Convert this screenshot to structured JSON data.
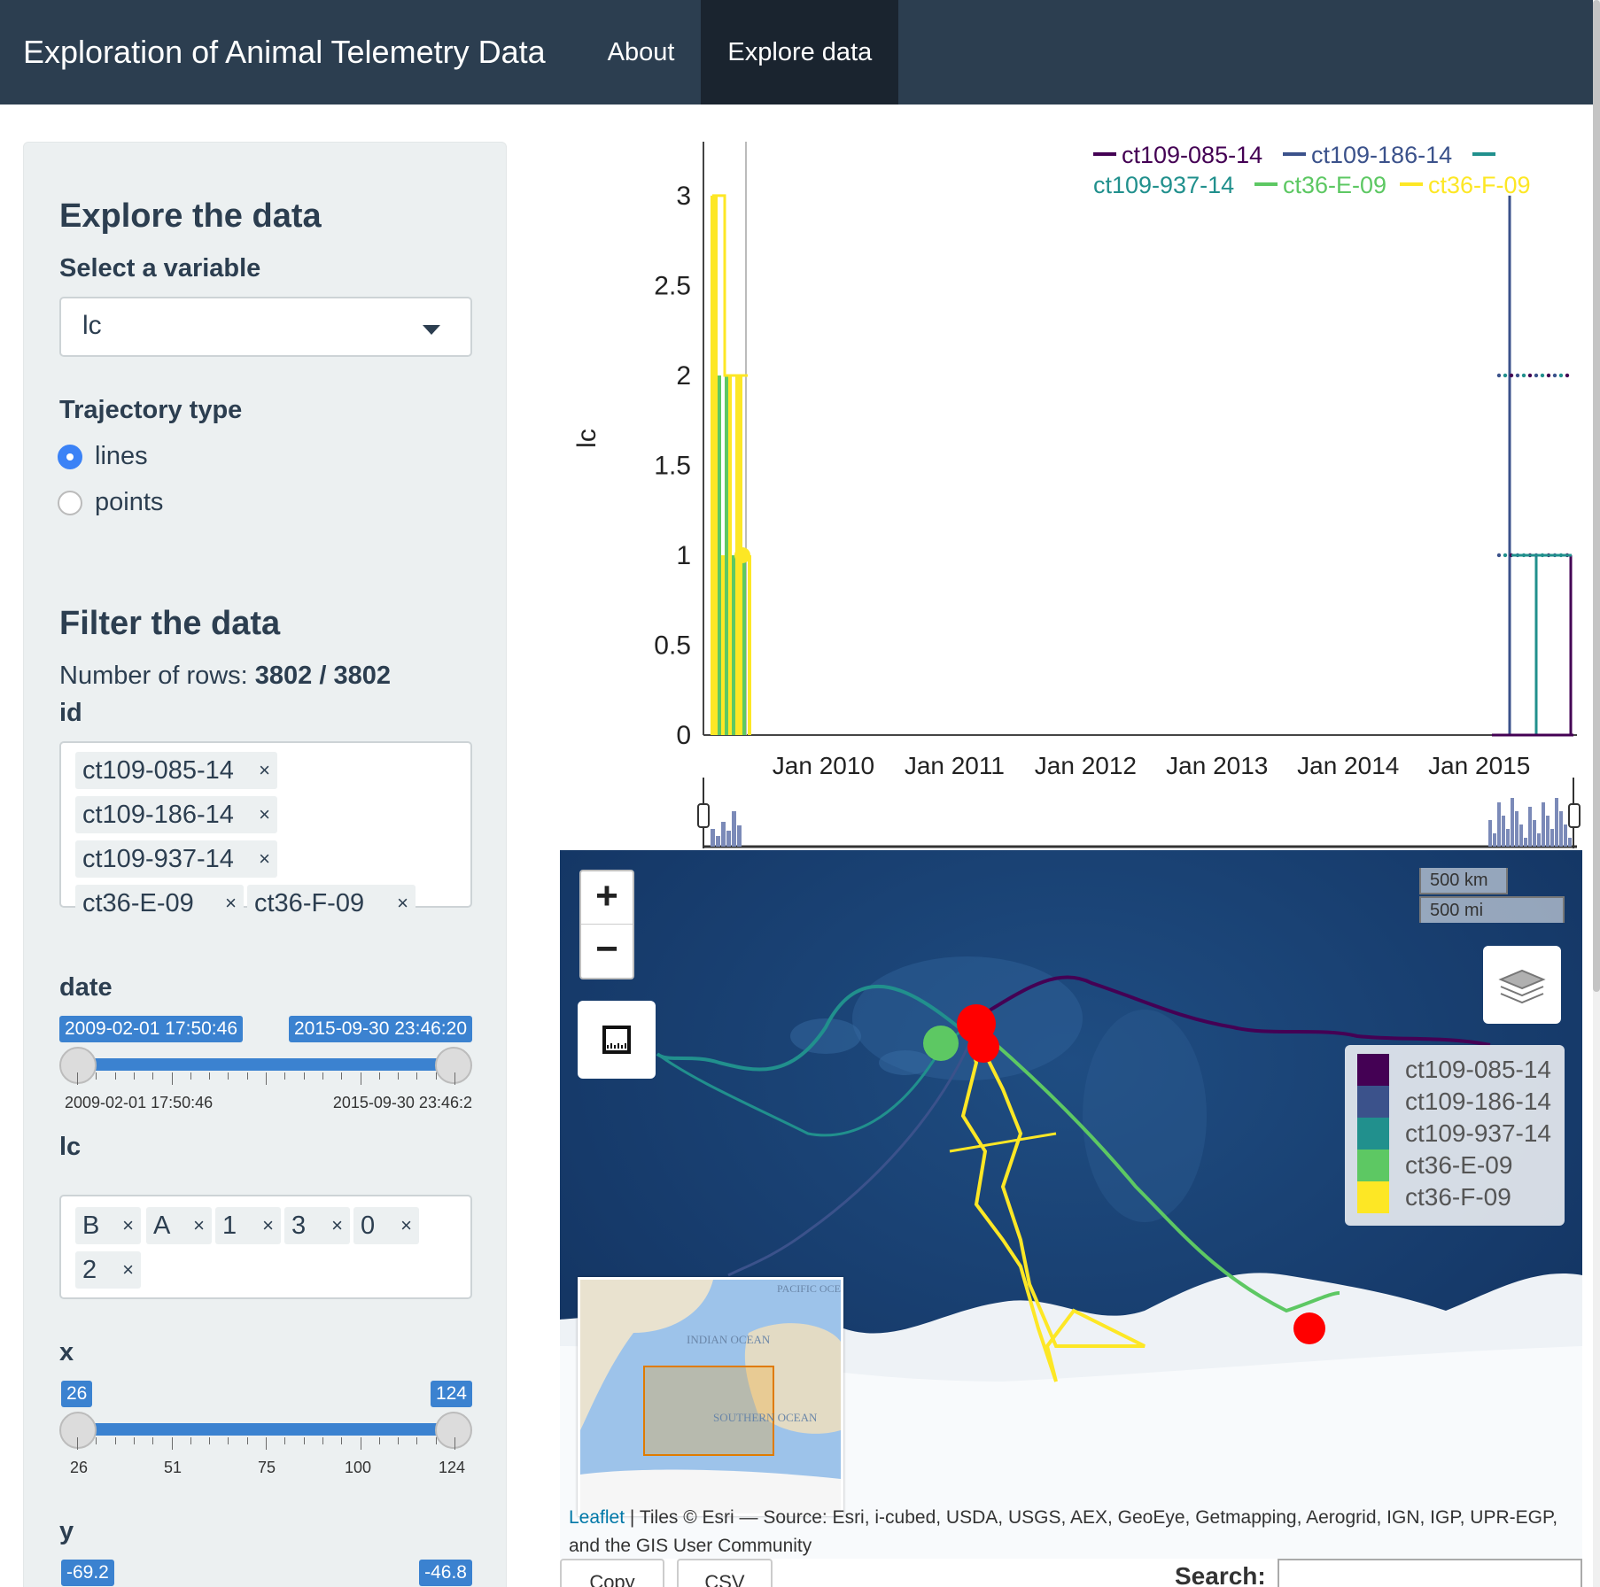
{
  "navbar": {
    "title": "Exploration of Animal Telemetry Data",
    "items": [
      "About",
      "Explore data"
    ],
    "active": "Explore data"
  },
  "sidebar": {
    "explore_heading": "Explore the data",
    "variable_label": "Select a variable",
    "variable_value": "lc",
    "trajectory_label": "Trajectory type",
    "trajectory_options": [
      "lines",
      "points"
    ],
    "trajectory_selected": "lines",
    "filter_heading": "Filter the data",
    "rows_prefix": "Number of rows:",
    "rows_value": "3802 / 3802",
    "id_label": "id",
    "id_tags": [
      "ct109-085-14",
      "ct109-186-14",
      "ct109-937-14",
      "ct36-E-09",
      "ct36-F-09"
    ],
    "date_label": "date",
    "date_from": "2009-02-01 17:50:46",
    "date_to": "2015-09-30 23:46:20",
    "date_tick_left": "2009-02-01 17:50:46",
    "date_tick_right": "2015-09-30 23:46:2",
    "lc_label": "lc",
    "lc_tags": [
      "B",
      "A",
      "1",
      "3",
      "0",
      "2"
    ],
    "x_label": "x",
    "x_from": "26",
    "x_to": "124",
    "x_ticks": [
      "26",
      "51",
      "75",
      "100",
      "124"
    ],
    "y_label": "y",
    "y_from": "-69.2",
    "y_to": "-46.8"
  },
  "chart_data": {
    "type": "line",
    "ylabel": "lc",
    "xlabel": "",
    "ylim": [
      0,
      3.3
    ],
    "yticks": [
      "0",
      "0.5",
      "1",
      "1.5",
      "2",
      "2.5",
      "3"
    ],
    "xticks": [
      "Jan 2010",
      "Jan 2011",
      "Jan 2012",
      "Jan 2013",
      "Jan 2014",
      "Jan 2015"
    ],
    "xlim": [
      "2009-02-01",
      "2015-09-30"
    ],
    "legend_position": "top-right",
    "series": [
      {
        "name": "ct109-085-14",
        "color": "#440154"
      },
      {
        "name": "ct109-186-14",
        "color": "#3b528b"
      },
      {
        "name": "ct109-937-14",
        "color": "#21908d"
      },
      {
        "name": "ct36-E-09",
        "color": "#5dc863"
      },
      {
        "name": "ct36-F-09",
        "color": "#fde725"
      }
    ]
  },
  "map": {
    "zoom_in": "+",
    "zoom_out": "−",
    "scale_km": "500 km",
    "scale_mi": "500 mi",
    "legend": [
      {
        "label": "ct109-085-14",
        "color": "#440154"
      },
      {
        "label": "ct109-186-14",
        "color": "#3b528b"
      },
      {
        "label": "ct109-937-14",
        "color": "#21908d"
      },
      {
        "label": "ct36-E-09",
        "color": "#5dc863"
      },
      {
        "label": "ct36-F-09",
        "color": "#fde725"
      }
    ],
    "minimap_labels": [
      "PACIFIC OCEAN",
      "INDIAN OCEAN",
      "SOUTHERN OCEAN"
    ],
    "attribution_link": "Leaflet",
    "attribution_text": "| Tiles © Esri — Source: Esri, i-cubed, USDA, USGS, AEX, GeoEye, Getmapping, Aerogrid, IGN, IGP, UPR-EGP, and the GIS User Community"
  },
  "table_controls": {
    "copy_label": "Copy",
    "csv_label": "CSV",
    "search_label": "Search:"
  },
  "icons": [
    "ruler-icon",
    "layers-icon",
    "caret-down-icon"
  ]
}
